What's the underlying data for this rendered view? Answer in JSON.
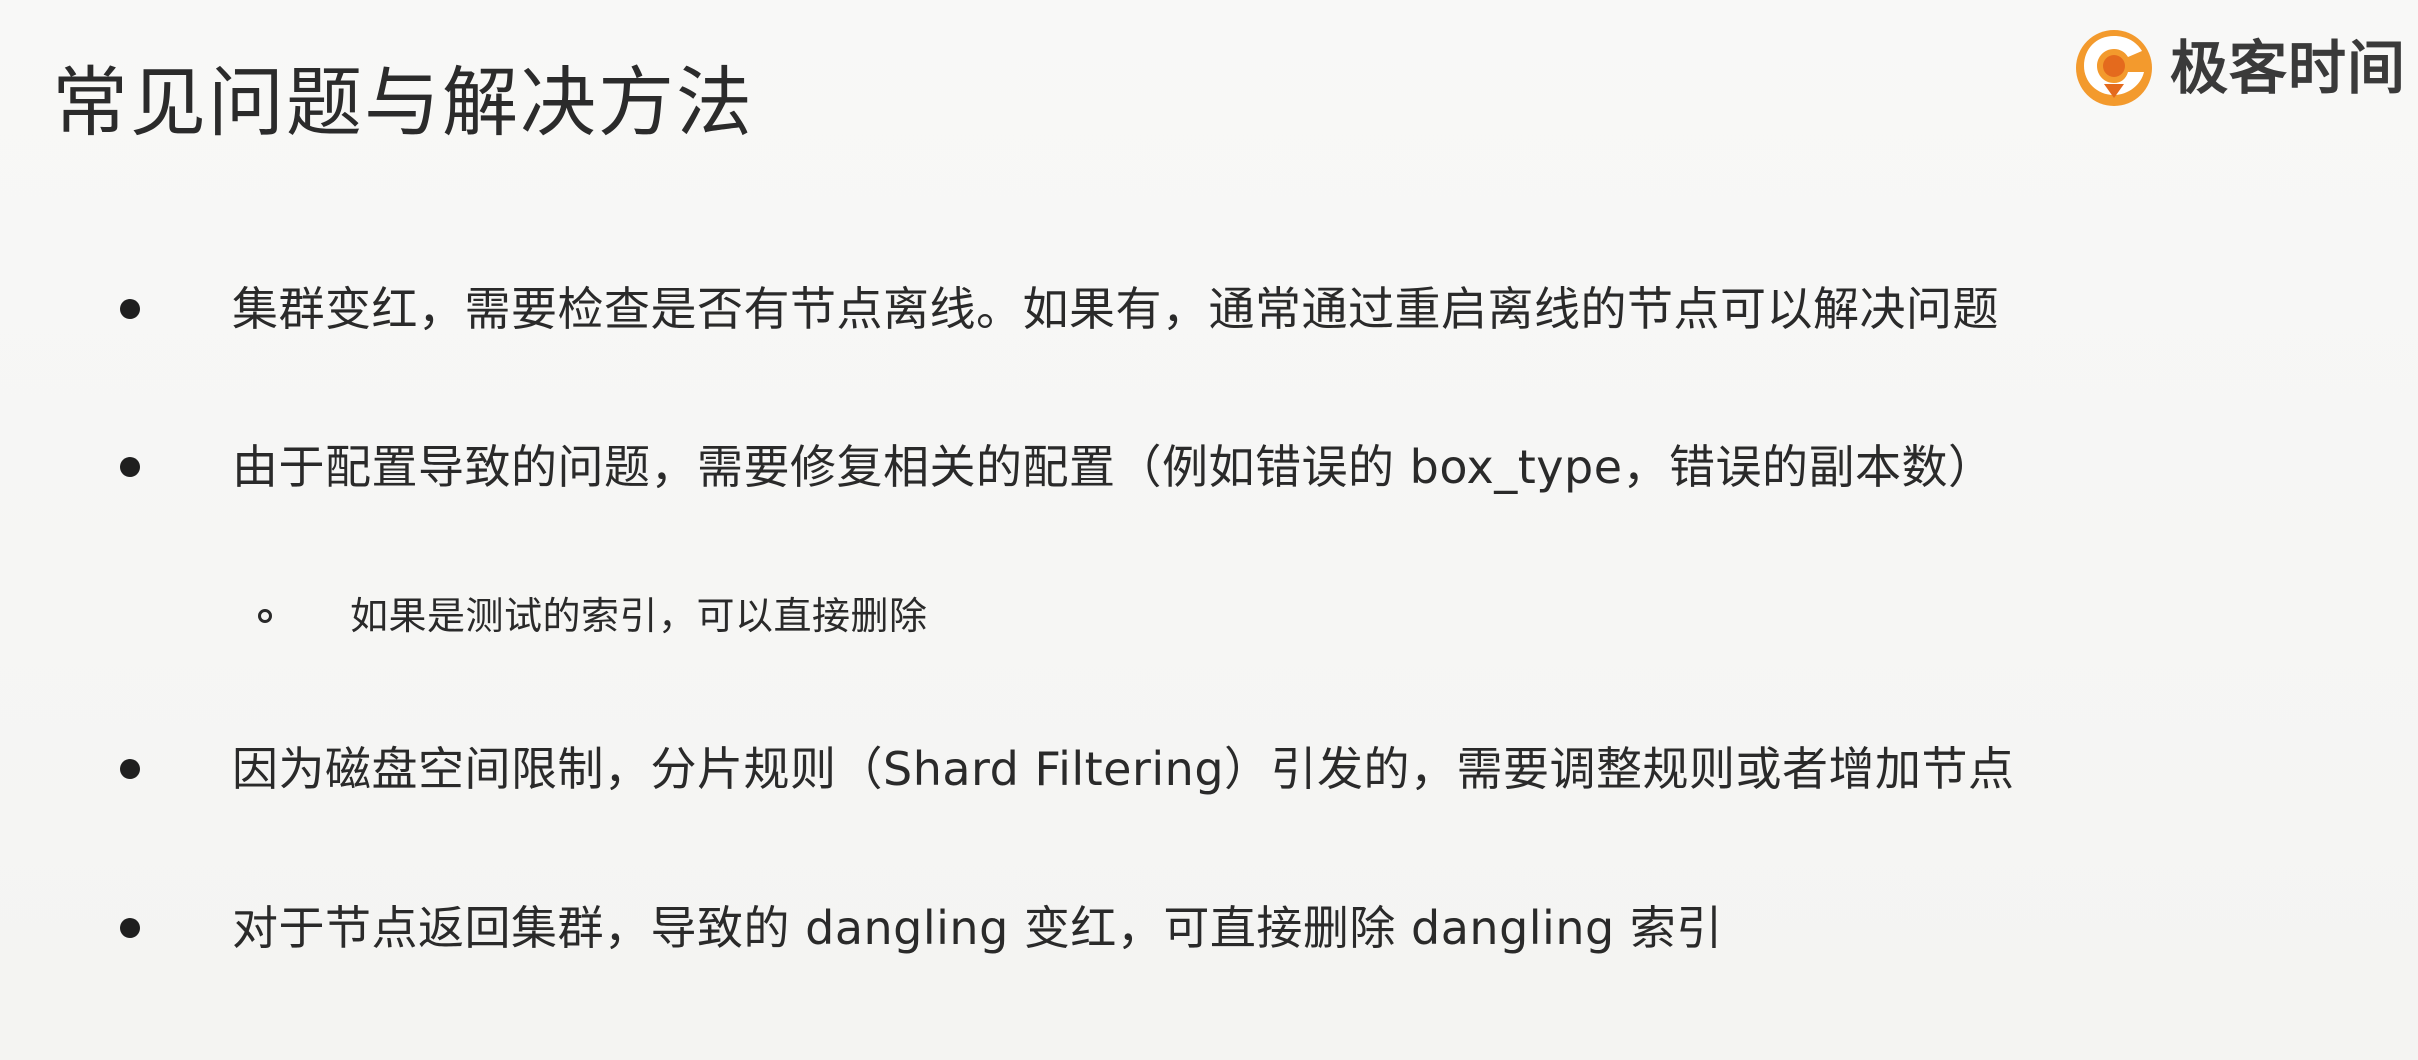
{
  "slide": {
    "title": "常见问题与解决方法",
    "brand": {
      "name": "极客时间",
      "logo_icon": "geektime-logo-icon",
      "colors": {
        "orange": "#f39a2d",
        "dark_orange": "#e46a1d"
      }
    },
    "bullets": [
      {
        "text": "集群变红，需要检查是否有节点离线。如果有，通常通过重启离线的节点可以解决问题"
      },
      {
        "text": "由于配置导致的问题，需要修复相关的配置（例如错误的 box_type，错误的副本数）",
        "subitems": [
          {
            "text": "如果是测试的索引，可以直接删除"
          }
        ]
      },
      {
        "text": "因为磁盘空间限制，分片规则（Shard Filtering）引发的，需要调整规则或者增加节点"
      },
      {
        "text": "对于节点返回集群，导致的 dangling 变红，可直接删除 dangling 索引"
      }
    ]
  }
}
